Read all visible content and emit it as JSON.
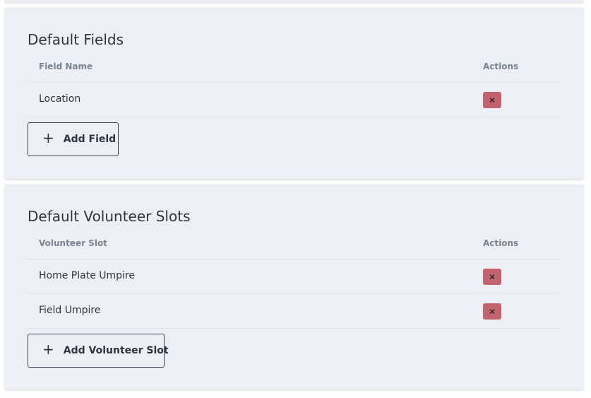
{
  "default_fields": {
    "title": "Default Fields",
    "columns": {
      "name": "Field Name",
      "actions": "Actions"
    },
    "rows": [
      {
        "name": "Location",
        "delete_label": "✕"
      }
    ],
    "add_button": {
      "icon": "+",
      "label": "Add Field"
    }
  },
  "default_slots": {
    "title": "Default Volunteer Slots",
    "columns": {
      "name": "Volunteer Slot",
      "actions": "Actions"
    },
    "rows": [
      {
        "name": "Home Plate Umpire",
        "delete_label": "✕"
      },
      {
        "name": "Field Umpire",
        "delete_label": "✕"
      }
    ],
    "add_button": {
      "icon": "+",
      "label": "Add Volunteer Slot"
    }
  },
  "colors": {
    "card_bg": "#eceff4",
    "delete_button": "#c3636d",
    "text": "#2e3440",
    "header_text": "#7b8391"
  },
  "icons": {
    "delete": "close-icon",
    "add": "plus-icon"
  }
}
